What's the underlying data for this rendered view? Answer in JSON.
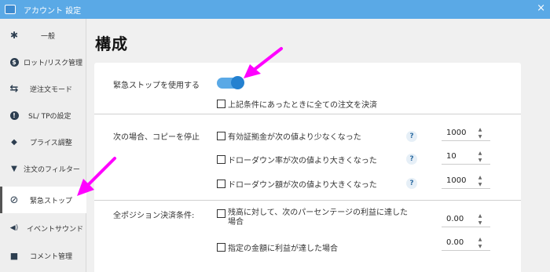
{
  "window": {
    "title": "アカウント 設定",
    "close_glyph": "×",
    "accent": "#5aa9e6"
  },
  "sidebar": {
    "items": [
      {
        "label": "一般",
        "icon": "gear-icon",
        "glyph": "✱"
      },
      {
        "label": "ロット/リスク管理",
        "icon": "dollar-circle-icon",
        "glyph": "$"
      },
      {
        "label": "逆注文モード",
        "icon": "swap-arrows-icon",
        "glyph": "⇆"
      },
      {
        "label": "SL/ TPの設定",
        "icon": "exclamation-circle-icon",
        "glyph": "!"
      },
      {
        "label": "プライス調整",
        "icon": "tag-icon",
        "glyph": "◆"
      },
      {
        "label": "注文のフィルター",
        "icon": "filter-icon",
        "glyph": "▼"
      },
      {
        "label": "緊急ストップ",
        "icon": "no-entry-icon",
        "glyph": "⊘",
        "active": true
      },
      {
        "label": "イベントサウンド",
        "icon": "speaker-icon",
        "glyph": "🔊"
      },
      {
        "label": "コメント管理",
        "icon": "comment-icon",
        "glyph": "■"
      }
    ]
  },
  "main": {
    "title": "構成",
    "emergency_stop": {
      "label": "緊急ストップを使用する",
      "toggle_on": true,
      "close_all_label": "上記条件にあったときに全ての注文を決済"
    },
    "copy_stop": {
      "label": "次の場合、コピーを停止",
      "rows": [
        {
          "label": "有効証拠金が次の値より少なくなった",
          "help": "?",
          "value": "1000"
        },
        {
          "label": "ドローダウン率が次の値より大きくなった",
          "help": "?",
          "value": "10"
        },
        {
          "label": "ドローダウン額が次の値より大きくなった",
          "help": "?",
          "value": "1000"
        }
      ]
    },
    "close_all": {
      "label": "全ポジション決済条件:",
      "rows": [
        {
          "label_line1": "残高に対して、次のパーセンテージの利益に達した",
          "label_line2": "場合",
          "value": "0.00"
        },
        {
          "label": "指定の金額に利益が達した場合",
          "value": "0.00"
        }
      ]
    },
    "spin_up": "▲",
    "spin_down": "▼"
  },
  "annotations": {
    "arrow_color": "#ff00ff"
  }
}
